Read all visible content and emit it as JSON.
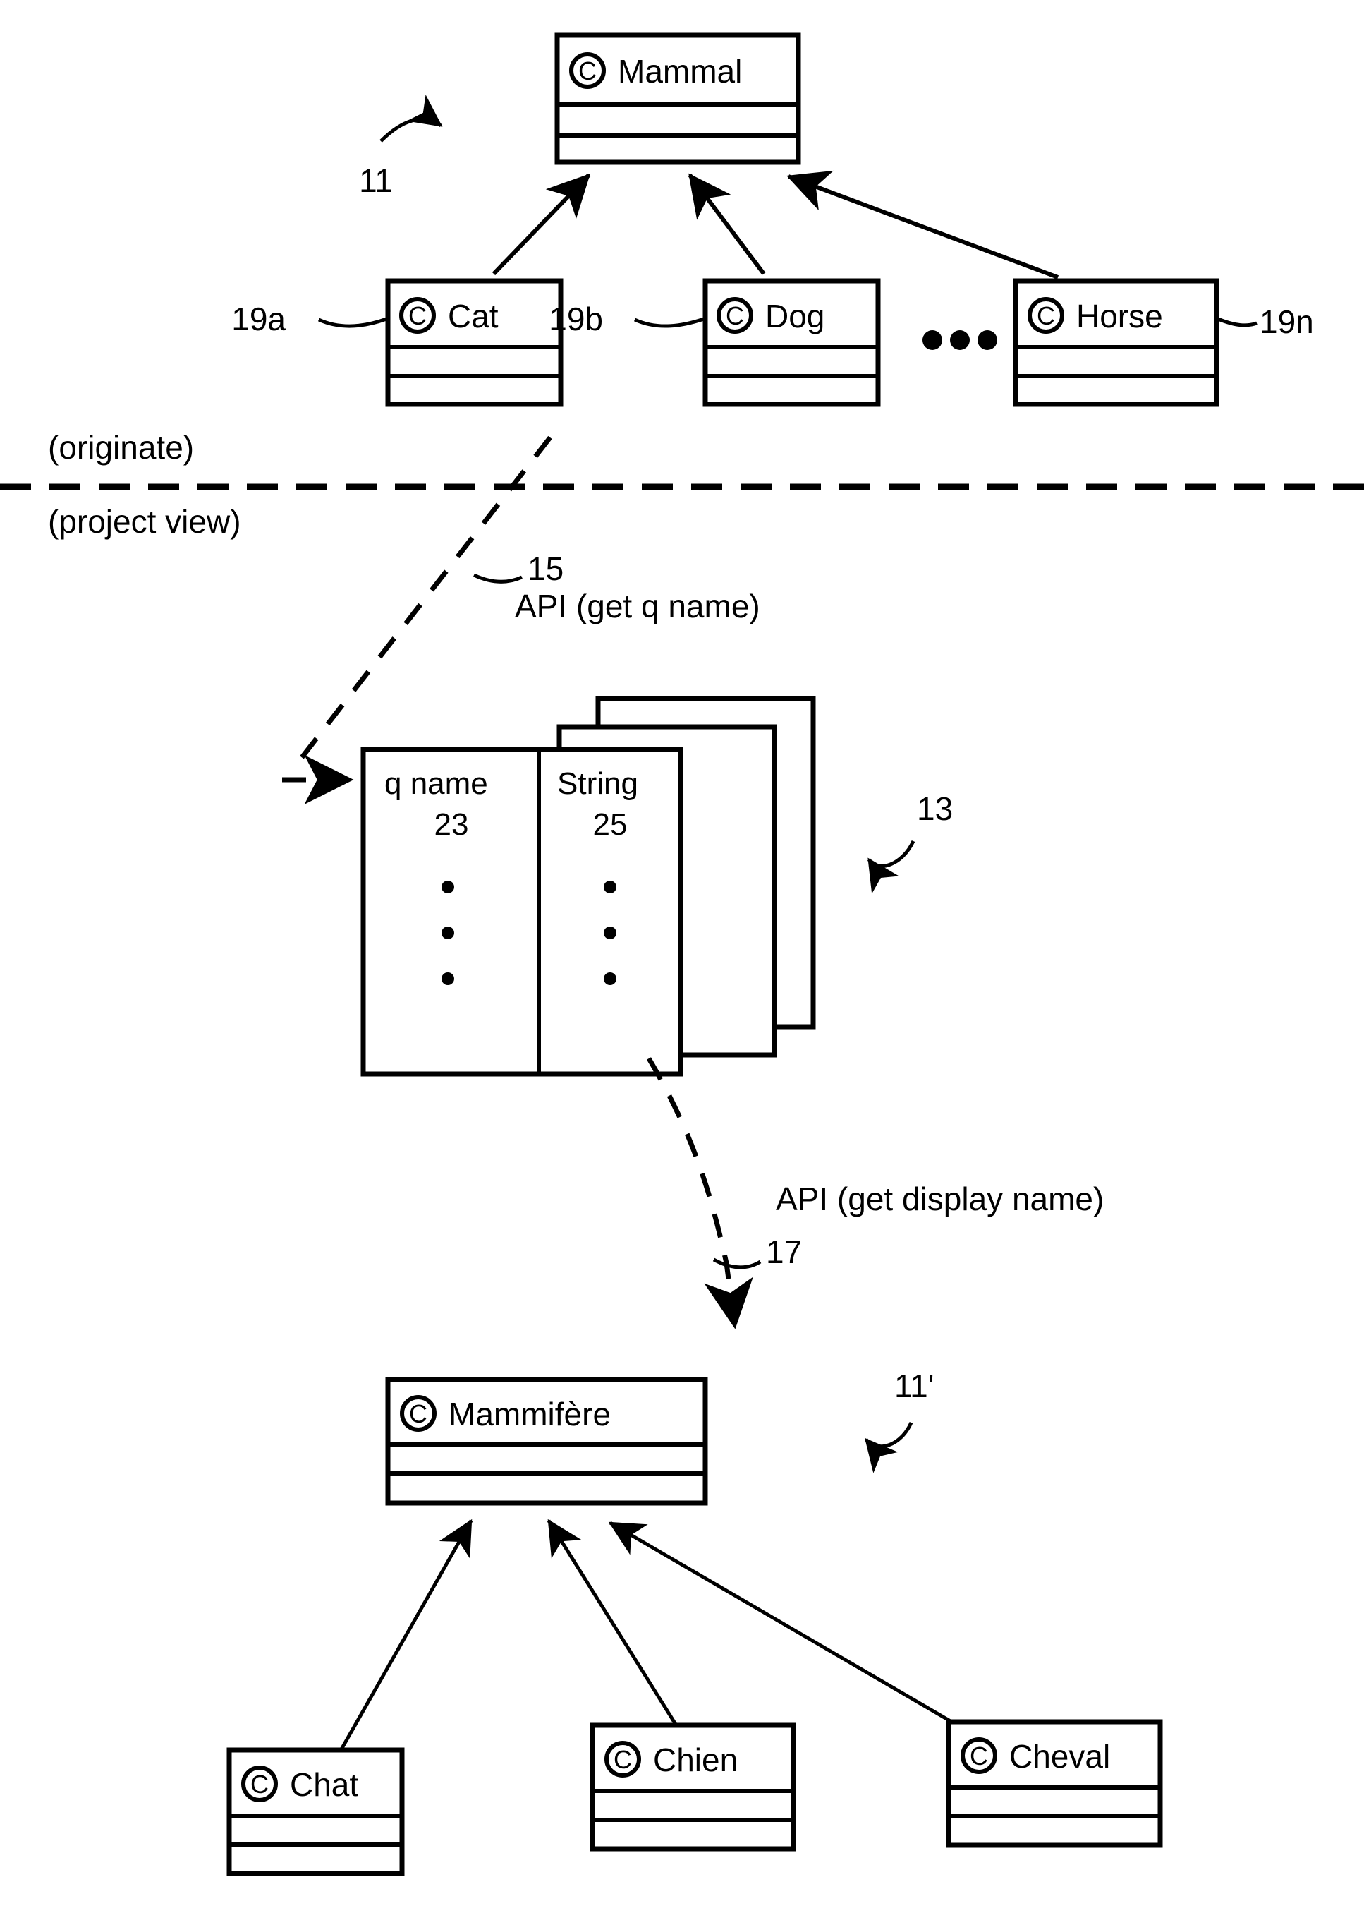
{
  "figure": {
    "type": "uml-class-diagram",
    "description": "Patent figure showing originate view and project view of class hierarchy with localization resource tables",
    "icon_glyph": "copyright-circle-c-icon"
  },
  "divider": {
    "above_label": "(originate)",
    "below_label": "(project view)"
  },
  "originate_view": {
    "ref_label": "11",
    "superclass": {
      "name": "Mammal",
      "icon": "class-icon"
    },
    "subclasses": [
      {
        "name": "Cat",
        "ref_label": "19a",
        "icon": "class-icon"
      },
      {
        "name": "Dog",
        "ref_label": "19b",
        "icon": "class-icon"
      },
      {
        "name": "Horse",
        "ref_label": "19n",
        "icon": "class-icon"
      }
    ],
    "ellipsis": "•••"
  },
  "api_upper": {
    "ref_label": "15",
    "label": "API (get q name)"
  },
  "resource_table": {
    "ref_label": "13",
    "stack_count": 3,
    "columns": [
      {
        "header": "q name",
        "ref_label": "23",
        "dots": 3
      },
      {
        "header": "String",
        "ref_label": "25",
        "dots": 3
      }
    ]
  },
  "api_lower": {
    "ref_label": "17",
    "label": "API (get display name)"
  },
  "project_view": {
    "ref_label": "11'",
    "superclass": {
      "name": "Mammifère",
      "icon": "class-icon"
    },
    "subclasses": [
      {
        "name": "Chat",
        "icon": "class-icon"
      },
      {
        "name": "Chien",
        "icon": "class-icon"
      },
      {
        "name": "Cheval",
        "icon": "class-icon"
      }
    ]
  },
  "colors": {
    "ink": "#000000",
    "paper": "#ffffff"
  }
}
